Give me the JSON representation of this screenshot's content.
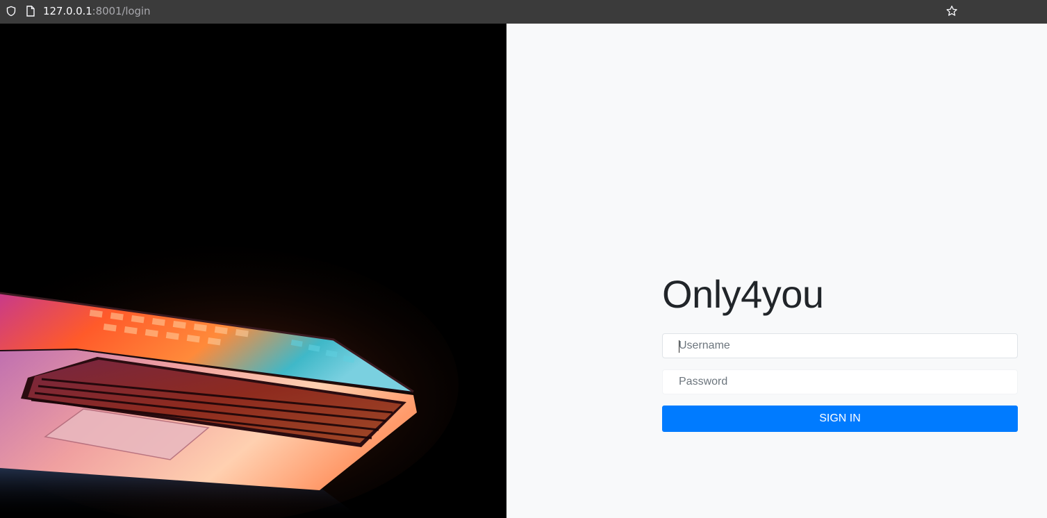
{
  "browser": {
    "url_host": "127.0.0.1",
    "url_rest": ":8001/login",
    "icons": [
      "shield-icon",
      "page-icon",
      "star-icon"
    ]
  },
  "login": {
    "title": "Only4you",
    "username_placeholder": "Username",
    "password_placeholder": "Password",
    "signin_label": "SIGN IN",
    "accent_color": "#007bff"
  }
}
